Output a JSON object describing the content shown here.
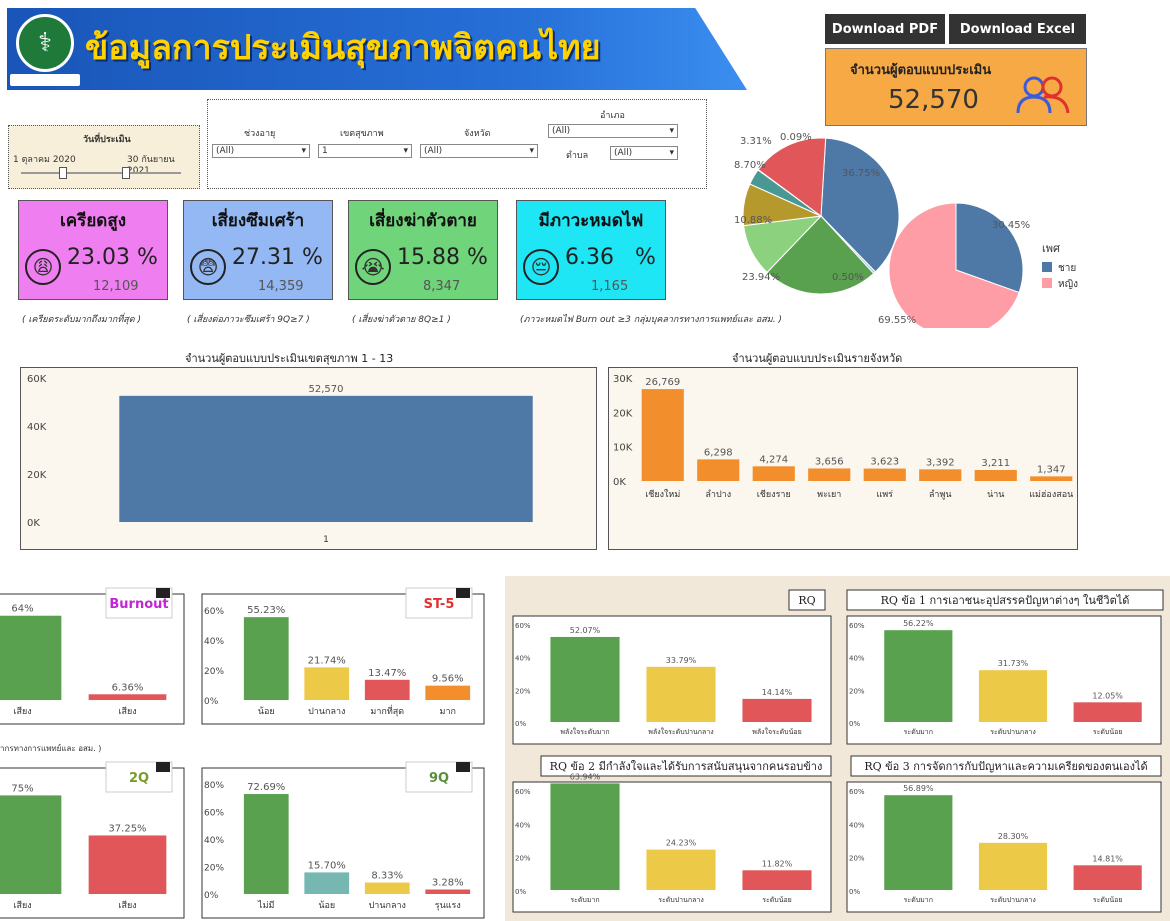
{
  "header": {
    "title": "ข้อมูลการประเมินสุขภาพจิตคนไทย",
    "download_pdf": "Download PDF",
    "download_excel": "Download Excel"
  },
  "respondents": {
    "label": "จำนวนผู้ตอบแบบประเมิน",
    "value": "52,570"
  },
  "filters": {
    "date_label": "วันที่ประเมิน",
    "date_from": "1 ตุลาคม 2020",
    "date_to": "30 กันยายน 2021",
    "age_label": "ช่วงอายุ",
    "age_value": "(All)",
    "region_label": "เขตสุขภาพ",
    "region_value": "1",
    "province_label": "จังหวัด",
    "province_value": "(All)",
    "district_label": "อำเภอ",
    "district_value": "(All)",
    "subdistrict_label": "ตำบล",
    "subdistrict_value": "(All)"
  },
  "cards": [
    {
      "title": "เครียดสูง",
      "pct": "23.03",
      "pct_sign": "%",
      "count": "12,109",
      "color": "#ef7ff0",
      "note": "( เครียดระดับมากถึงมากที่สุด )"
    },
    {
      "title": "เสี่ยงซึมเศร้า",
      "pct": "27.31",
      "pct_sign": "%",
      "count": "14,359",
      "color": "#93b8f4",
      "note": "( เสี่ยงต่อภาวะซึมเศร้า 9Q≥7 )"
    },
    {
      "title": "เสี่ยงฆ่าตัวตาย",
      "pct": "15.88",
      "pct_sign": "%",
      "count": "8,347",
      "color": "#6fd47a",
      "note": "( เสี่ยงฆ่าตัวตาย 8Q≥1 )"
    },
    {
      "title": "มีภาวะหมดไฟ",
      "pct": "6.36",
      "pct_sign": "%",
      "count": "1,165",
      "color": "#1ee6f5",
      "note": "(ภาวะหมดไฟ Burn out ≥3  กลุ่มบุคลากรทางการแพทย์และ อสม. )"
    }
  ],
  "chart_data": [
    {
      "type": "pie",
      "id": "province_pie",
      "values": [
        36.75,
        0.5,
        23.94,
        10.88,
        8.7,
        3.31,
        0.09,
        15.83
      ],
      "labels": [
        "36.75%",
        "0.50%",
        "23.94%",
        "10.88%",
        "8.70%",
        "3.31%",
        "0.09%",
        ""
      ],
      "colors": [
        "#4e79a7",
        "#a0cbe8",
        "#59a14f",
        "#8cd17d",
        "#b6992d",
        "#499894",
        "#f1ce63",
        "#e15759"
      ]
    },
    {
      "type": "pie",
      "id": "gender_pie",
      "title": "เพศ",
      "values": [
        30.45,
        69.55
      ],
      "labels": [
        "30.45%",
        "69.55%"
      ],
      "series": [
        "ชาย",
        "หญิง"
      ],
      "colors": [
        "#4e79a7",
        "#ff9da7"
      ]
    },
    {
      "type": "bar",
      "id": "region_bar",
      "title": "จำนวนผู้ตอบแบบประเมินเขตสุขภาพ 1 - 13",
      "categories": [
        "1"
      ],
      "values": [
        52570
      ],
      "value_labels": [
        "52,570"
      ],
      "ylim": [
        0,
        60000
      ],
      "yticks": [
        "60K",
        "40K",
        "20K",
        "0K"
      ],
      "color": "#4e79a7"
    },
    {
      "type": "bar",
      "id": "province_bar",
      "title": "จำนวนผู้ตอบแบบประเมินรายจังหวัด",
      "categories": [
        "เชียงใหม่",
        "ลำปาง",
        "เชียงราย",
        "พะเยา",
        "แพร่",
        "ลำพูน",
        "น่าน",
        "แม่ฮ่องสอน"
      ],
      "values": [
        26769,
        6298,
        4274,
        3656,
        3623,
        3392,
        3211,
        1347
      ],
      "value_labels": [
        "26,769",
        "6,298",
        "4,274",
        "3,656",
        "3,623",
        "3,392",
        "3,211",
        "1,347"
      ],
      "ylim": [
        0,
        30000
      ],
      "yticks": [
        "30K",
        "20K",
        "10K",
        "0K"
      ],
      "color": "#f28e2b"
    },
    {
      "type": "bar",
      "id": "burnout",
      "title": "Burnout",
      "categories": [
        "เสียง",
        "เสียง"
      ],
      "values": [
        93.64,
        6.36
      ],
      "value_labels": [
        "64%",
        "6.36%"
      ],
      "colors": [
        "#59a14f",
        "#e15759"
      ]
    },
    {
      "type": "bar",
      "id": "st5",
      "title": "ST-5",
      "categories": [
        "น้อย",
        "ปานกลาง",
        "มากที่สุด",
        "มาก"
      ],
      "values": [
        55.23,
        21.74,
        13.47,
        9.56
      ],
      "value_labels": [
        "55.23%",
        "21.74%",
        "13.47%",
        "9.56%"
      ],
      "yticks": [
        "60%",
        "40%",
        "20%",
        "0%"
      ],
      "colors": [
        "#59a14f",
        "#edc948",
        "#e15759",
        "#f28e2b"
      ]
    },
    {
      "type": "bar",
      "id": "q2",
      "title": "2Q",
      "categories": [
        "เสียง",
        "เสียง"
      ],
      "values": [
        62.75,
        37.25
      ],
      "value_labels": [
        "75%",
        "37.25%"
      ],
      "colors": [
        "#59a14f",
        "#e15759"
      ]
    },
    {
      "type": "bar",
      "id": "q9",
      "title": "9Q",
      "categories": [
        "ไม่มี",
        "น้อย",
        "ปานกลาง",
        "รุนแรง"
      ],
      "values": [
        72.69,
        15.7,
        8.33,
        3.28
      ],
      "value_labels": [
        "72.69%",
        "15.70%",
        "8.33%",
        "3.28%"
      ],
      "yticks": [
        "80%",
        "60%",
        "40%",
        "20%",
        "0%"
      ],
      "colors": [
        "#59a14f",
        "#76b7b2",
        "#edc948",
        "#e15759"
      ]
    },
    {
      "type": "bar",
      "id": "rq",
      "title": "RQ",
      "categories": [
        "พลังใจระดับมาก",
        "พลังใจระดับปานกลาง",
        "พลังใจระดับน้อย"
      ],
      "values": [
        52.07,
        33.79,
        14.14
      ],
      "value_labels": [
        "52.07%",
        "33.79%",
        "14.14%"
      ]
    },
    {
      "type": "bar",
      "id": "rq1",
      "title": "RQ ข้อ 1 การเอาชนะอุปสรรคปัญหาต่างๆ ในชีวิตได้",
      "categories": [
        "ระดับมาก",
        "ระดับปานกลาง",
        "ระดับน้อย"
      ],
      "values": [
        56.22,
        31.73,
        12.05
      ],
      "value_labels": [
        "56.22%",
        "31.73%",
        "12.05%"
      ]
    },
    {
      "type": "bar",
      "id": "rq2",
      "title": "RQ ข้อ 2 มีกำลังใจและได้รับการสนับสนุนจากคนรอบข้าง",
      "categories": [
        "ระดับมาก",
        "ระดับปานกลาง",
        "ระดับน้อย"
      ],
      "values": [
        63.94,
        24.23,
        11.82
      ],
      "value_labels": [
        "63.94%",
        "24.23%",
        "11.82%"
      ]
    },
    {
      "type": "bar",
      "id": "rq3",
      "title": "RQ ข้อ 3 การจัดการกับปัญหาและความเครียดของตนเองได้",
      "categories": [
        "ระดับมาก",
        "ระดับปานกลาง",
        "ระดับน้อย"
      ],
      "values": [
        56.89,
        28.3,
        14.81
      ],
      "value_labels": [
        "56.89%",
        "28.30%",
        "14.81%"
      ]
    }
  ],
  "notes": {
    "burnout_note": "ากรทางการแพทย์และ อสม. )"
  },
  "rq_axis": [
    "60%",
    "40%",
    "20%",
    "0%"
  ],
  "rq_colors": [
    "#59a14f",
    "#edc948",
    "#e15759"
  ]
}
